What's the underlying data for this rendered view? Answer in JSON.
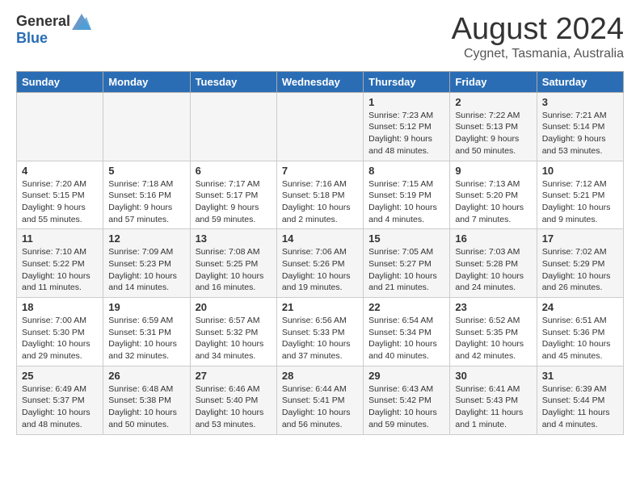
{
  "header": {
    "logo_general": "General",
    "logo_blue": "Blue",
    "month_title": "August 2024",
    "location": "Cygnet, Tasmania, Australia"
  },
  "days_of_week": [
    "Sunday",
    "Monday",
    "Tuesday",
    "Wednesday",
    "Thursday",
    "Friday",
    "Saturday"
  ],
  "weeks": [
    [
      {
        "day": "",
        "info": ""
      },
      {
        "day": "",
        "info": ""
      },
      {
        "day": "",
        "info": ""
      },
      {
        "day": "",
        "info": ""
      },
      {
        "day": "1",
        "info": "Sunrise: 7:23 AM\nSunset: 5:12 PM\nDaylight: 9 hours\nand 48 minutes."
      },
      {
        "day": "2",
        "info": "Sunrise: 7:22 AM\nSunset: 5:13 PM\nDaylight: 9 hours\nand 50 minutes."
      },
      {
        "day": "3",
        "info": "Sunrise: 7:21 AM\nSunset: 5:14 PM\nDaylight: 9 hours\nand 53 minutes."
      }
    ],
    [
      {
        "day": "4",
        "info": "Sunrise: 7:20 AM\nSunset: 5:15 PM\nDaylight: 9 hours\nand 55 minutes."
      },
      {
        "day": "5",
        "info": "Sunrise: 7:18 AM\nSunset: 5:16 PM\nDaylight: 9 hours\nand 57 minutes."
      },
      {
        "day": "6",
        "info": "Sunrise: 7:17 AM\nSunset: 5:17 PM\nDaylight: 9 hours\nand 59 minutes."
      },
      {
        "day": "7",
        "info": "Sunrise: 7:16 AM\nSunset: 5:18 PM\nDaylight: 10 hours\nand 2 minutes."
      },
      {
        "day": "8",
        "info": "Sunrise: 7:15 AM\nSunset: 5:19 PM\nDaylight: 10 hours\nand 4 minutes."
      },
      {
        "day": "9",
        "info": "Sunrise: 7:13 AM\nSunset: 5:20 PM\nDaylight: 10 hours\nand 7 minutes."
      },
      {
        "day": "10",
        "info": "Sunrise: 7:12 AM\nSunset: 5:21 PM\nDaylight: 10 hours\nand 9 minutes."
      }
    ],
    [
      {
        "day": "11",
        "info": "Sunrise: 7:10 AM\nSunset: 5:22 PM\nDaylight: 10 hours\nand 11 minutes."
      },
      {
        "day": "12",
        "info": "Sunrise: 7:09 AM\nSunset: 5:23 PM\nDaylight: 10 hours\nand 14 minutes."
      },
      {
        "day": "13",
        "info": "Sunrise: 7:08 AM\nSunset: 5:25 PM\nDaylight: 10 hours\nand 16 minutes."
      },
      {
        "day": "14",
        "info": "Sunrise: 7:06 AM\nSunset: 5:26 PM\nDaylight: 10 hours\nand 19 minutes."
      },
      {
        "day": "15",
        "info": "Sunrise: 7:05 AM\nSunset: 5:27 PM\nDaylight: 10 hours\nand 21 minutes."
      },
      {
        "day": "16",
        "info": "Sunrise: 7:03 AM\nSunset: 5:28 PM\nDaylight: 10 hours\nand 24 minutes."
      },
      {
        "day": "17",
        "info": "Sunrise: 7:02 AM\nSunset: 5:29 PM\nDaylight: 10 hours\nand 26 minutes."
      }
    ],
    [
      {
        "day": "18",
        "info": "Sunrise: 7:00 AM\nSunset: 5:30 PM\nDaylight: 10 hours\nand 29 minutes."
      },
      {
        "day": "19",
        "info": "Sunrise: 6:59 AM\nSunset: 5:31 PM\nDaylight: 10 hours\nand 32 minutes."
      },
      {
        "day": "20",
        "info": "Sunrise: 6:57 AM\nSunset: 5:32 PM\nDaylight: 10 hours\nand 34 minutes."
      },
      {
        "day": "21",
        "info": "Sunrise: 6:56 AM\nSunset: 5:33 PM\nDaylight: 10 hours\nand 37 minutes."
      },
      {
        "day": "22",
        "info": "Sunrise: 6:54 AM\nSunset: 5:34 PM\nDaylight: 10 hours\nand 40 minutes."
      },
      {
        "day": "23",
        "info": "Sunrise: 6:52 AM\nSunset: 5:35 PM\nDaylight: 10 hours\nand 42 minutes."
      },
      {
        "day": "24",
        "info": "Sunrise: 6:51 AM\nSunset: 5:36 PM\nDaylight: 10 hours\nand 45 minutes."
      }
    ],
    [
      {
        "day": "25",
        "info": "Sunrise: 6:49 AM\nSunset: 5:37 PM\nDaylight: 10 hours\nand 48 minutes."
      },
      {
        "day": "26",
        "info": "Sunrise: 6:48 AM\nSunset: 5:38 PM\nDaylight: 10 hours\nand 50 minutes."
      },
      {
        "day": "27",
        "info": "Sunrise: 6:46 AM\nSunset: 5:40 PM\nDaylight: 10 hours\nand 53 minutes."
      },
      {
        "day": "28",
        "info": "Sunrise: 6:44 AM\nSunset: 5:41 PM\nDaylight: 10 hours\nand 56 minutes."
      },
      {
        "day": "29",
        "info": "Sunrise: 6:43 AM\nSunset: 5:42 PM\nDaylight: 10 hours\nand 59 minutes."
      },
      {
        "day": "30",
        "info": "Sunrise: 6:41 AM\nSunset: 5:43 PM\nDaylight: 11 hours\nand 1 minute."
      },
      {
        "day": "31",
        "info": "Sunrise: 6:39 AM\nSunset: 5:44 PM\nDaylight: 11 hours\nand 4 minutes."
      }
    ]
  ]
}
